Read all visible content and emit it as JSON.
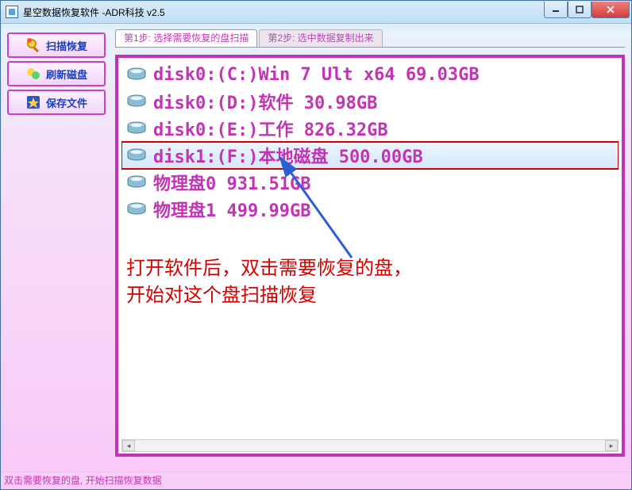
{
  "window": {
    "title": "星空数据恢复软件   -ADR科技 v2.5"
  },
  "sidebar": {
    "scan": {
      "label": "扫描恢复"
    },
    "refresh": {
      "label": "刷新磁盘"
    },
    "save": {
      "label": "保存文件"
    }
  },
  "tabs": {
    "step1": "第1步: 选择需要恢复的盘扫描",
    "step2": "第2步: 选中数据复制出来"
  },
  "drives": [
    {
      "text": "disk0:(C:)Win 7 Ult x64 69.03GB"
    },
    {
      "text": "disk0:(D:)软件 30.98GB"
    },
    {
      "text": "disk0:(E:)工作 826.32GB"
    },
    {
      "text": "disk1:(F:)本地磁盘 500.00GB",
      "selected": true
    },
    {
      "text": "物理盘0 931.51GB"
    },
    {
      "text": "物理盘1 499.99GB"
    }
  ],
  "annotation": {
    "line1": "打开软件后，双击需要恢复的盘，",
    "line2": "开始对这个盘扫描恢复"
  },
  "status": "双击需要恢复的盘, 开始扫描恢复数据",
  "colors": {
    "accent": "#c234b4",
    "highlight_border": "#d40000",
    "link_blue": "#1a40c0"
  }
}
